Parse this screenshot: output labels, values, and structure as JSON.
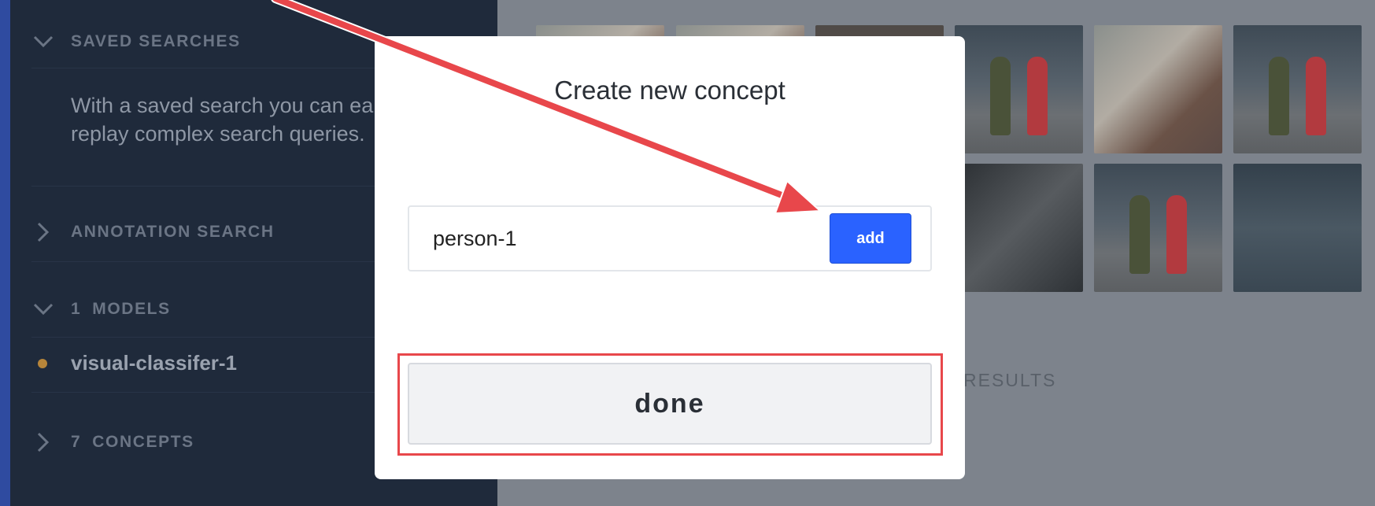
{
  "sidebar": {
    "saved_searches": {
      "title": "SAVED SEARCHES",
      "description_line1": "With a saved search you can ea",
      "description_line2": "replay complex search queries."
    },
    "annotation_search": {
      "title": "ANNOTATION SEARCH"
    },
    "models": {
      "count": "1",
      "title": "MODELS",
      "items": [
        {
          "name": "visual-classifer-1",
          "status_color": "#b7853a"
        }
      ]
    },
    "concepts": {
      "count": "7",
      "title": "CONCEPTS"
    }
  },
  "main": {
    "results_label": "RESULTS"
  },
  "modal": {
    "title": "Create new concept",
    "input_value": "person-1",
    "add_label": "add",
    "done_label": "done"
  },
  "colors": {
    "sidebar_bg": "#1f2a3b",
    "accent_blue": "#2a62ff",
    "annotation_red": "#e8474b"
  },
  "icons": [
    "chevron-down-icon",
    "chevron-right-icon",
    "status-dot-icon",
    "arrow-annotation"
  ]
}
